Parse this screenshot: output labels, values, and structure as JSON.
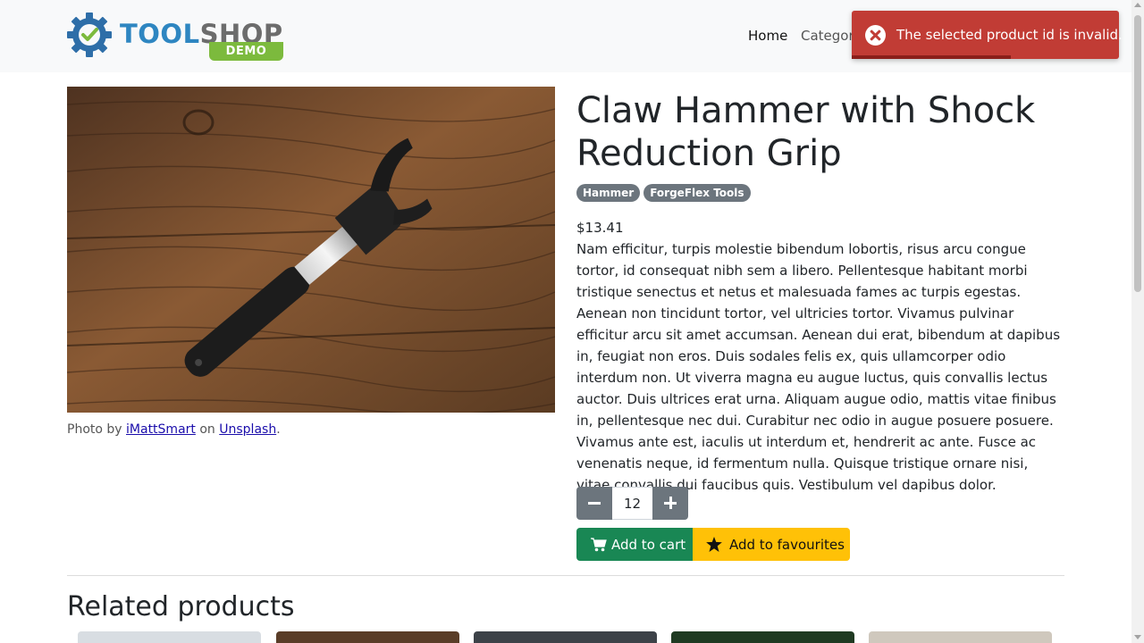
{
  "brand": {
    "name_part1": "TOOL",
    "name_part2": "SHOP",
    "tag": "DEMO"
  },
  "nav": {
    "home": "Home",
    "categories": "Categor"
  },
  "toast": {
    "message": "The selected product id is invalid.",
    "color": "#c13c35"
  },
  "product": {
    "title": "Claw Hammer with Shock Reduction Grip",
    "badges": [
      "Hammer",
      "ForgeFlex Tools"
    ],
    "price": "$13.41",
    "description": "Nam efficitur, turpis molestie bibendum lobortis, risus arcu congue tortor, id consequat nibh sem a libero. Pellentesque habitant morbi tristique senectus et netus et malesuada fames ac turpis egestas. Aenean non tincidunt tortor, vel ultricies tortor. Vivamus pulvinar efficitur arcu sit amet accumsan. Aenean dui erat, bibendum at dapibus in, feugiat non eros. Duis sodales felis ex, quis ullamcorper odio interdum non. Ut viverra magna eu augue luctus, quis convallis lectus auctor. Duis ultrices erat urna. Aliquam augue odio, mattis vitae finibus in, pellentesque nec dui. Curabitur nec odio in augue posuere posuere. Vivamus ante est, iaculis ut interdum et, hendrerit ac ante. Fusce ac venenatis neque, id fermentum nulla. Quisque tristique ornare nisi, vitae convallis dui faucibus quis. Vestibulum vel dapibus dolor.",
    "quantity": "12",
    "caption": {
      "prefix": "Photo by",
      "author": "iMattSmart",
      "mid": "on",
      "site": "Unsplash",
      "suffix": "."
    }
  },
  "actions": {
    "add_to_cart": "Add to cart",
    "add_to_favourites": "Add to favourites"
  },
  "related": {
    "heading": "Related products"
  },
  "colors": {
    "cart": "#198754",
    "favourites": "#ffc107",
    "badge": "#6c757d"
  }
}
